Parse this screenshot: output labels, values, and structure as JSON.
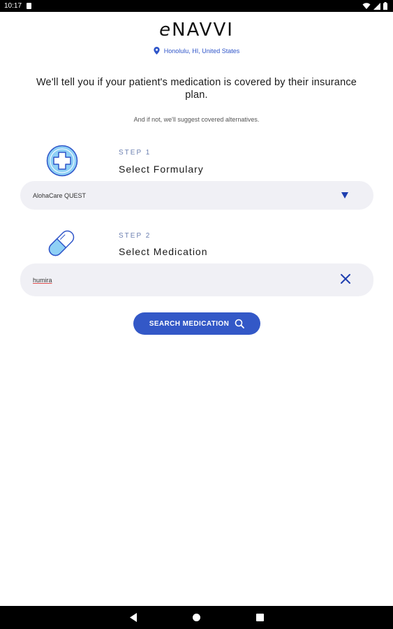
{
  "status_bar": {
    "time": "10:17"
  },
  "header": {
    "logo_e": "e",
    "logo_text": "NAVVI",
    "location": "Honolulu, HI, United States"
  },
  "intro": {
    "headline": "We'll tell you if your patient's medication is covered by their insurance plan.",
    "subline": "And if not, we'll suggest covered alternatives."
  },
  "step1": {
    "label": "STEP 1",
    "title": "Select Formulary",
    "selected_formulary": "AlohaCare QUEST"
  },
  "step2": {
    "label": "STEP 2",
    "title": "Select Medication",
    "medication_value": "humira"
  },
  "search_button": {
    "label": "SEARCH MEDICATION"
  },
  "colors": {
    "accent": "#3358c7",
    "field_bg": "#f0f0f5",
    "icon_fill": "#8fd0f5",
    "icon_stroke": "#2f55c9"
  },
  "icons": {
    "formulary": "medical-cross-icon",
    "medication": "pill-capsule-icon",
    "location": "location-pin-icon",
    "search": "search-icon",
    "clear": "close-icon",
    "dropdown": "caret-down-icon"
  }
}
